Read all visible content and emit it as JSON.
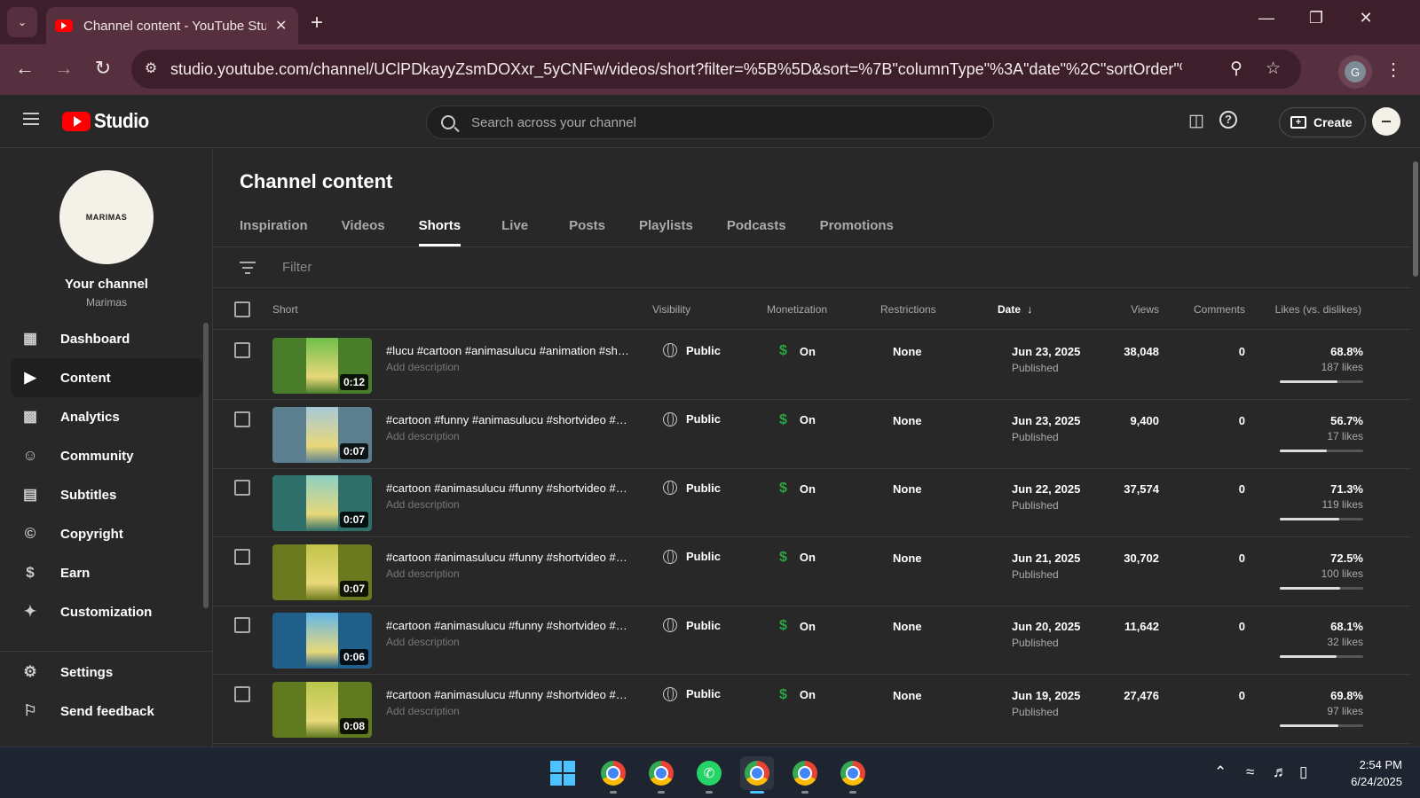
{
  "browser": {
    "tab_title": "Channel content - YouTube Studio",
    "url": "studio.youtube.com/channel/UClPDkayyZsmDOXxr_5yCNFw/videos/short?filter=%5B%5D&sort=%7B\"columnType\"%3A\"date\"%2C\"sortOrder\"%3A\"DESCE...",
    "profile_initial": "G"
  },
  "header": {
    "logo_text": "Studio",
    "search_placeholder": "Search across your channel",
    "create_label": "Create"
  },
  "sidebar": {
    "avatar_text": "MARIMAS",
    "your_channel": "Your channel",
    "channel_name": "Marimas",
    "items": [
      {
        "label": "Dashboard",
        "icon": "dashboard-icon"
      },
      {
        "label": "Content",
        "icon": "content-icon",
        "active": true
      },
      {
        "label": "Analytics",
        "icon": "analytics-icon"
      },
      {
        "label": "Community",
        "icon": "community-icon"
      },
      {
        "label": "Subtitles",
        "icon": "subtitles-icon"
      },
      {
        "label": "Copyright",
        "icon": "copyright-icon"
      },
      {
        "label": "Earn",
        "icon": "earn-icon"
      },
      {
        "label": "Customization",
        "icon": "customization-icon"
      }
    ],
    "bottom_items": [
      {
        "label": "Settings",
        "icon": "settings-icon"
      },
      {
        "label": "Send feedback",
        "icon": "feedback-icon"
      }
    ]
  },
  "main": {
    "title": "Channel content",
    "tabs": [
      "Inspiration",
      "Videos",
      "Shorts",
      "Live",
      "Posts",
      "Playlists",
      "Podcasts",
      "Promotions"
    ],
    "active_tab": "Shorts",
    "filter_placeholder": "Filter",
    "columns": {
      "short": "Short",
      "visibility": "Visibility",
      "monetization": "Monetization",
      "restrictions": "Restrictions",
      "date": "Date",
      "views": "Views",
      "comments": "Comments",
      "likes": "Likes (vs. dislikes)"
    },
    "rows": [
      {
        "duration": "0:12",
        "title": "#lucu #cartoon #animasulucu #animation #shor...",
        "description": "Add description",
        "visibility": "Public",
        "monetization": "On",
        "restrictions": "None",
        "date": "Jun 23, 2025",
        "status": "Published",
        "views": "38,048",
        "comments": "0",
        "likes_pct": "68.8%",
        "likes_count": "187 likes",
        "likes_ratio": 0.688
      },
      {
        "duration": "0:07",
        "title": "#cartoon #funny #animasulucu #shortvideo #an...",
        "description": "Add description",
        "visibility": "Public",
        "monetization": "On",
        "restrictions": "None",
        "date": "Jun 23, 2025",
        "status": "Published",
        "views": "9,400",
        "comments": "0",
        "likes_pct": "56.7%",
        "likes_count": "17 likes",
        "likes_ratio": 0.567
      },
      {
        "duration": "0:07",
        "title": "#cartoon #animasulucu #funny #shortvideo #an...",
        "description": "Add description",
        "visibility": "Public",
        "monetization": "On",
        "restrictions": "None",
        "date": "Jun 22, 2025",
        "status": "Published",
        "views": "37,574",
        "comments": "0",
        "likes_pct": "71.3%",
        "likes_count": "119 likes",
        "likes_ratio": 0.713
      },
      {
        "duration": "0:07",
        "title": "#cartoon #animasulucu #funny #shortvideo #an...",
        "description": "Add description",
        "visibility": "Public",
        "monetization": "On",
        "restrictions": "None",
        "date": "Jun 21, 2025",
        "status": "Published",
        "views": "30,702",
        "comments": "0",
        "likes_pct": "72.5%",
        "likes_count": "100 likes",
        "likes_ratio": 0.725
      },
      {
        "duration": "0:06",
        "title": "#cartoon #animasulucu #funny #shortvideo #an...",
        "description": "Add description",
        "visibility": "Public",
        "monetization": "On",
        "restrictions": "None",
        "date": "Jun 20, 2025",
        "status": "Published",
        "views": "11,642",
        "comments": "0",
        "likes_pct": "68.1%",
        "likes_count": "32 likes",
        "likes_ratio": 0.681
      },
      {
        "duration": "0:08",
        "title": "#cartoon #animasulucu #funny #shortvideo #an...",
        "description": "Add description",
        "visibility": "Public",
        "monetization": "On",
        "restrictions": "None",
        "date": "Jun 19, 2025",
        "status": "Published",
        "views": "27,476",
        "comments": "0",
        "likes_pct": "69.8%",
        "likes_count": "97 likes",
        "likes_ratio": 0.698
      }
    ]
  },
  "taskbar": {
    "time": "2:54 PM",
    "date": "6/24/2025"
  },
  "colors": {
    "accent": "#ff0000",
    "monetization_on": "#2ba640",
    "chrome_frame": "#57303f"
  }
}
